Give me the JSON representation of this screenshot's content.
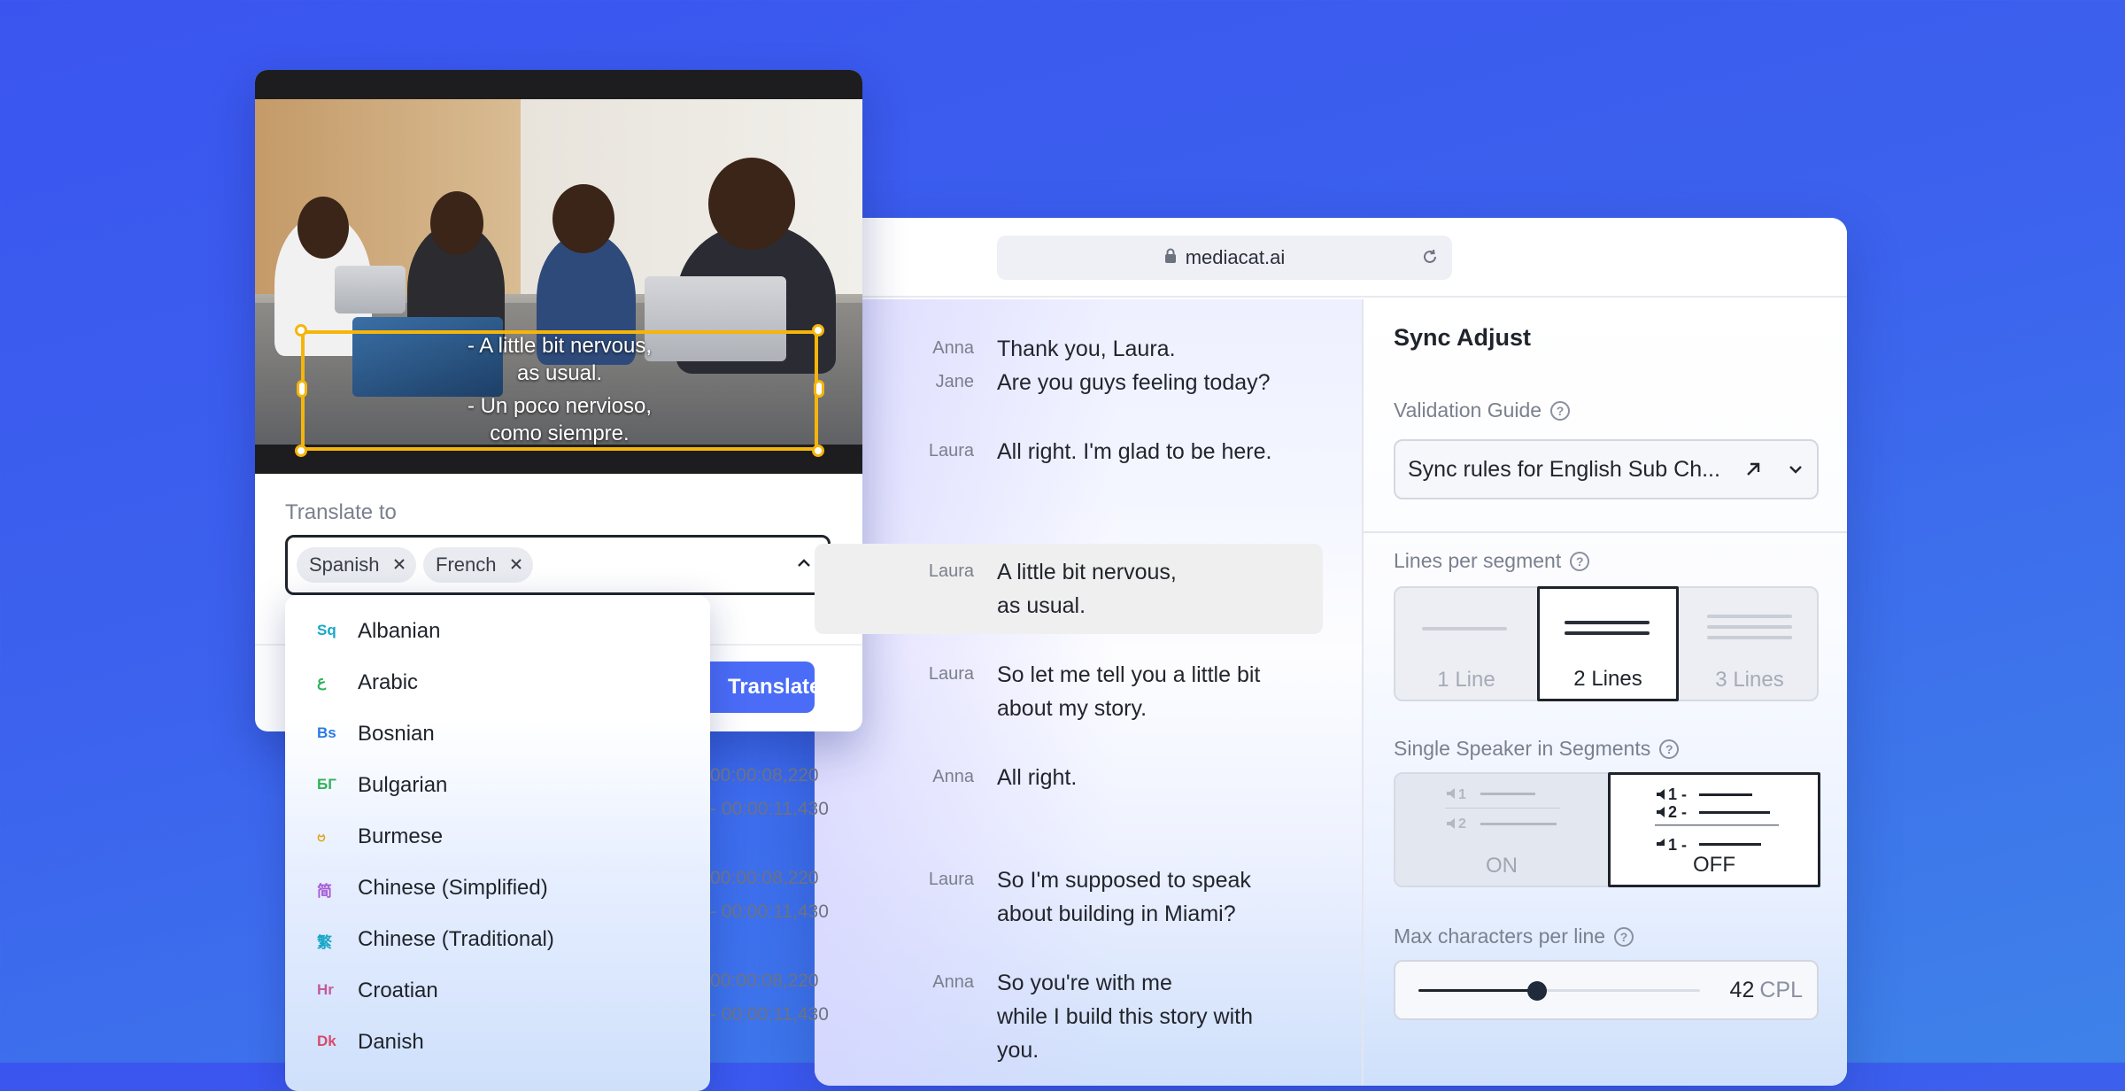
{
  "browser": {
    "url": "mediacat.ai"
  },
  "transcript": {
    "segments": [
      {
        "lines": [
          {
            "speaker": "Anna",
            "text": "Thank you, Laura."
          },
          {
            "speaker": "Jane",
            "text": "Are you guys feeling today?"
          }
        ]
      },
      {
        "lines": [
          {
            "speaker": "Laura",
            "text": "All right. I'm glad to be here."
          }
        ]
      },
      {
        "lines": [
          {
            "speaker": "Laura",
            "text": "A little bit nervous,"
          },
          {
            "speaker": "",
            "text": "as usual."
          }
        ],
        "selected": true
      },
      {
        "lines": [
          {
            "speaker": "Laura",
            "text": "So let me tell you a little bit"
          },
          {
            "speaker": "",
            "text": "about my story."
          }
        ]
      },
      {
        "lines": [
          {
            "speaker": "Anna",
            "text": "All right."
          }
        ]
      },
      {
        "lines": [
          {
            "speaker": "Laura",
            "text": "So I'm supposed to speak"
          },
          {
            "speaker": "",
            "text": "about building in Miami?"
          }
        ]
      },
      {
        "lines": [
          {
            "speaker": "Anna",
            "text": "So you're with me"
          },
          {
            "speaker": "",
            "text": "while I build this story with"
          },
          {
            "speaker": "",
            "text": "you."
          }
        ]
      }
    ],
    "timecodes": [
      {
        "start": "00:00:08,220",
        "end": "- 00:00:11,430"
      },
      {
        "start": "00:00:08,220",
        "end": "- 00:00:11,430"
      },
      {
        "start": "00:00:08,220",
        "end": "- 00:00:11,430"
      }
    ]
  },
  "sync_adjust": {
    "title": "Sync Adjust",
    "validation_guide": {
      "label": "Validation Guide",
      "value": "Sync rules for English Sub Ch..."
    },
    "lines_per_segment": {
      "label": "Lines per segment",
      "options": [
        "1 Line",
        "2 Lines",
        "3 Lines"
      ],
      "selected": "2 Lines"
    },
    "single_speaker": {
      "label": "Single Speaker in Segments",
      "options": [
        "ON",
        "OFF"
      ],
      "selected": "OFF",
      "glyph_numbers": [
        "1",
        "2"
      ],
      "glyph_numbers_off": [
        "1 -",
        "2 -",
        "1 -"
      ]
    },
    "max_chars": {
      "label": "Max characters per line",
      "value": "42",
      "unit": "CPL",
      "slider_fraction": 0.42
    }
  },
  "video": {
    "subtitle_lines": [
      "- A little bit nervous,",
      "as usual.",
      "- Un poco nervioso,",
      "como siempre."
    ]
  },
  "translate": {
    "label": "Translate to",
    "selected": [
      "Spanish",
      "French"
    ],
    "button": "Translate",
    "languages": [
      {
        "abbr": "Sq",
        "name": "Albanian",
        "color": "#1aa7c9"
      },
      {
        "abbr": "ع",
        "name": "Arabic",
        "color": "#2fb35a"
      },
      {
        "abbr": "Bs",
        "name": "Bosnian",
        "color": "#2a7be4"
      },
      {
        "abbr": "БГ",
        "name": "Bulgarian",
        "color": "#2fb35a"
      },
      {
        "abbr": "ဗ",
        "name": "Burmese",
        "color": "#e0a316"
      },
      {
        "abbr": "简",
        "name": "Chinese (Simplified)",
        "color": "#a85ad6"
      },
      {
        "abbr": "繁",
        "name": "Chinese (Traditional)",
        "color": "#1aa7c9"
      },
      {
        "abbr": "Hr",
        "name": "Croatian",
        "color": "#c45a9a"
      },
      {
        "abbr": "Dk",
        "name": "Danish",
        "color": "#d94a6a"
      }
    ]
  },
  "colors": {
    "accent": "#4a6cf7",
    "selection": "#f5b50a",
    "background": "#3a55ef"
  }
}
